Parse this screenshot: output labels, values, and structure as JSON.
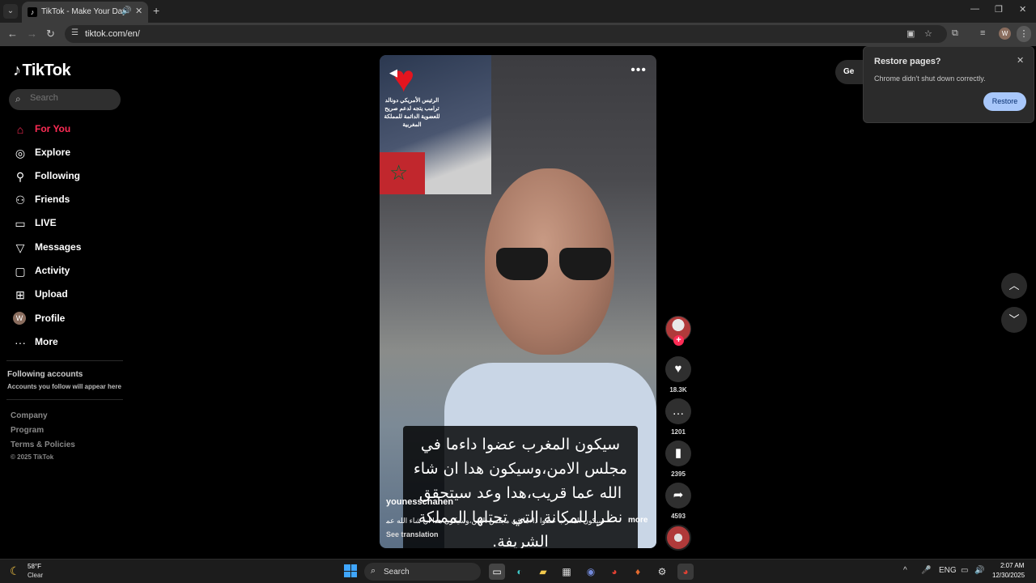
{
  "browser": {
    "tab_title": "TikTok - Make Your Day",
    "url": "tiktok.com/en/"
  },
  "sidebar": {
    "logo": "TikTok",
    "search_placeholder": "Search",
    "nav": [
      {
        "label": "For You",
        "icon": "home-icon",
        "active": true
      },
      {
        "label": "Explore",
        "icon": "compass-icon"
      },
      {
        "label": "Following",
        "icon": "following-icon"
      },
      {
        "label": "Friends",
        "icon": "friends-icon"
      },
      {
        "label": "LIVE",
        "icon": "live-icon"
      },
      {
        "label": "Messages",
        "icon": "messages-icon"
      },
      {
        "label": "Activity",
        "icon": "activity-icon"
      },
      {
        "label": "Upload",
        "icon": "upload-icon"
      },
      {
        "label": "Profile",
        "icon": "avatar",
        "avatar_letter": "W"
      },
      {
        "label": "More",
        "icon": "more-icon"
      }
    ],
    "following_title": "Following accounts",
    "following_sub": "Accounts you follow will appear here",
    "footer_links": [
      "Company",
      "Program",
      "Terms & Policies"
    ],
    "copyright": "© 2025 TikTok"
  },
  "video": {
    "overlay_text": "الرئيس الأمريكي دونالد ترامب يتجه لدعم صريح للعضوية الدائمة للمملكة المغربية",
    "subtitle": "سيكون المغرب عضوا داءما في مجلس الامن،وسيكون هدا ان شاء الله عما قريب،هدا وعد سيتحقق نظرا للمكانة التي تحتلها المملكة الشريفة.",
    "author": "younesschahen",
    "caption": "سيكون المغرب عضوا داءما في مجلس الامن،وسيكون هدا ان شاء الله عما",
    "more_label": "more",
    "see_translation": "See translation"
  },
  "actions": {
    "likes": "18.3K",
    "comments": "1201",
    "saves": "2395",
    "shares": "4593"
  },
  "get_app_label": "Ge",
  "popup": {
    "title": "Restore pages?",
    "text": "Chrome didn't shut down correctly.",
    "button": "Restore"
  },
  "taskbar": {
    "temp": "58°F",
    "weather": "Clear",
    "search": "Search",
    "lang": "ENG",
    "time": "2:07 AM",
    "date": "12/30/2025"
  },
  "colors": {
    "accent": "#fe2c55",
    "popup_button": "#a8c7fa"
  }
}
